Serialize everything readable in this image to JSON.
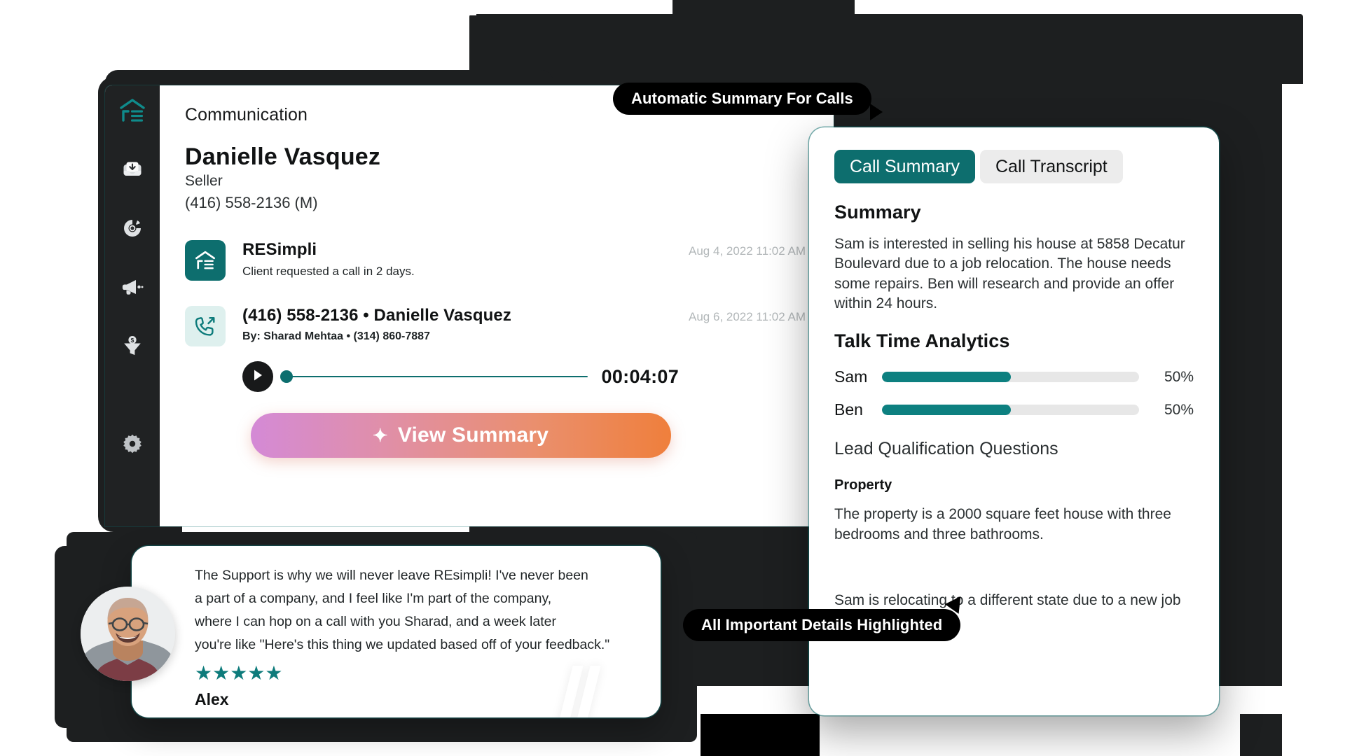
{
  "sidebar": {
    "items": [
      {
        "name": "logo",
        "icon": "resimpli-logo-icon"
      },
      {
        "name": "inbox",
        "icon": "inbox-download-icon"
      },
      {
        "name": "activity",
        "icon": "target-dot-icon"
      },
      {
        "name": "marketing",
        "icon": "megaphone-icon"
      },
      {
        "name": "funnel",
        "icon": "dollar-funnel-icon"
      },
      {
        "name": "settings",
        "icon": "gear-icon"
      }
    ]
  },
  "main": {
    "section_title": "Communication",
    "lead": {
      "name": "Danielle Vasquez",
      "role": "Seller",
      "phone": "(416) 558-2136  (M)"
    },
    "messages": [
      {
        "icon": "resimpli-logo-icon",
        "title": "RESimpli",
        "subtitle": "Client requested a call in 2 days.",
        "time": "Aug 4, 2022 11:02 AM"
      },
      {
        "icon": "outgoing-call-icon",
        "title": "(416) 558-2136 • Danielle Vasquez",
        "subtitle": "By: Sharad Mehtaa • (314) 860-7887",
        "time": "Aug 6, 2022 11:02 AM"
      }
    ],
    "player": {
      "duration": "00:04:07",
      "progress_percent": 0
    },
    "view_summary_label": "View Summary",
    "view_summary_spark": "✦"
  },
  "summary_panel": {
    "tabs": [
      {
        "label": "Call Summary",
        "active": true
      },
      {
        "label": "Call Transcript",
        "active": false
      }
    ],
    "summary_heading": "Summary",
    "summary_text": "Sam is interested in selling his house at 5858 Decatur Boulevard due to a job relocation. The house needs some repairs. Ben will research and provide an offer within 24 hours.",
    "analytics_heading": "Talk Time Analytics",
    "lead_qual_heading": "Lead Qualification Questions",
    "property_heading": "Property",
    "property_text": "The property is a 2000 square feet house with three bedrooms and three bathrooms.",
    "relocation_text": "Sam is relocating to a different state due to a new job opportunity."
  },
  "chart_data": {
    "type": "bar",
    "title": "Talk Time Analytics",
    "categories": [
      "Sam",
      "Ben"
    ],
    "values": [
      50,
      50
    ],
    "value_labels": [
      "50%",
      "50%"
    ],
    "xlabel": "",
    "ylabel": "",
    "ylim": [
      0,
      100
    ],
    "orientation": "horizontal",
    "grid": false,
    "legend": "none"
  },
  "tooltips": {
    "top": "Automatic Summary For Calls",
    "bottom": "All Important Details Highlighted"
  },
  "testimonial": {
    "lines": [
      "The Support is why we will never leave REsimpli! I've never been",
      "a part of a company, and I feel like I'm part of the company,",
      "where I can hop on a call with you Sharad, and a week later",
      "you're like \"Here's this thing we updated based off of your feedback.\""
    ],
    "stars": "★★★★★",
    "author": "Alex"
  },
  "colors": {
    "teal": "#0d6e6e",
    "teal_bright": "#0d8080",
    "dark": "#1d1f20",
    "sidebar": "#202223"
  }
}
